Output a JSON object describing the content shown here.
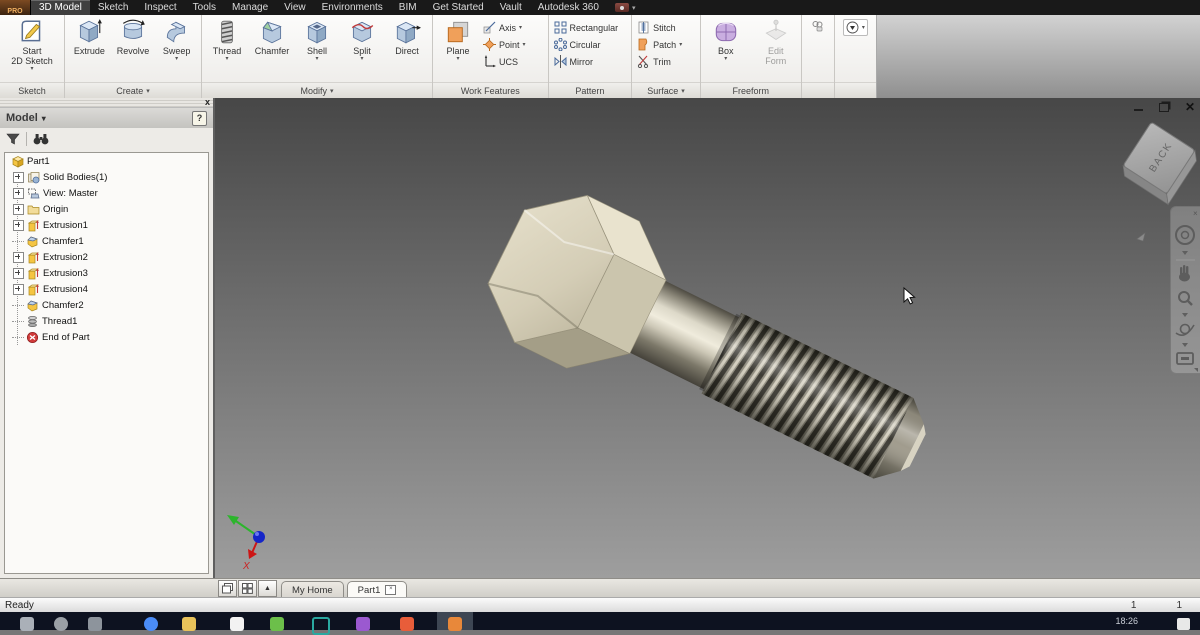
{
  "menu": {
    "logo": "PRO",
    "tabs": [
      "3D Model",
      "Sketch",
      "Inspect",
      "Tools",
      "Manage",
      "View",
      "Environments",
      "BIM",
      "Get Started",
      "Vault",
      "Autodesk 360"
    ],
    "active_tab": "3D Model"
  },
  "ribbon": {
    "captions": [
      "Sketch",
      "Create",
      "Modify",
      "Work Features",
      "Pattern",
      "Surface",
      "Freeform"
    ],
    "buttons": {
      "start1": "Start",
      "start2": "2D Sketch",
      "extrude": "Extrude",
      "revolve": "Revolve",
      "sweep": "Sweep",
      "thread": "Thread",
      "chamfer": "Chamfer",
      "shell": "Shell",
      "split": "Split",
      "direct": "Direct",
      "plane": "Plane",
      "axis": "Axis",
      "point": "Point",
      "ucs": "UCS",
      "rectangular": "Rectangular",
      "circular": "Circular",
      "mirror": "Mirror",
      "stitch": "Stitch",
      "patch": "Patch",
      "trim": "Trim",
      "box": "Box",
      "edit1": "Edit",
      "edit2": "Form"
    }
  },
  "browser": {
    "title": "Model",
    "help": "?",
    "items": [
      "Part1",
      "Solid Bodies(1)",
      "View: Master",
      "Origin",
      "Extrusion1",
      "Chamfer1",
      "Extrusion2",
      "Extrusion3",
      "Extrusion4",
      "Chamfer2",
      "Thread1",
      "End of Part"
    ]
  },
  "viewport": {
    "viewcube_label": "BACK",
    "triad_x_label": "X"
  },
  "doc_tabs": {
    "items": [
      "My Home",
      "Part1"
    ],
    "active": "Part1"
  },
  "statusbar": {
    "ready": "Ready",
    "right": [
      "1",
      "1"
    ]
  },
  "taskbar": {
    "time": "18:26"
  },
  "colors": {
    "menubar": "#191919",
    "ribbon_bg": "#f4f3f1",
    "viewport_top": "#474747",
    "viewport_bottom": "#9e9e9e",
    "taskbar": "#0d1220",
    "bolt_head": "#d8d2bb",
    "bolt_shank_highlight": "#f0ecdd",
    "bolt_thread_dark": "#35332c",
    "icon_blue": "#b9cce4",
    "icon_orange": "#f0a05a",
    "icon_purple": "#c9aee0"
  }
}
